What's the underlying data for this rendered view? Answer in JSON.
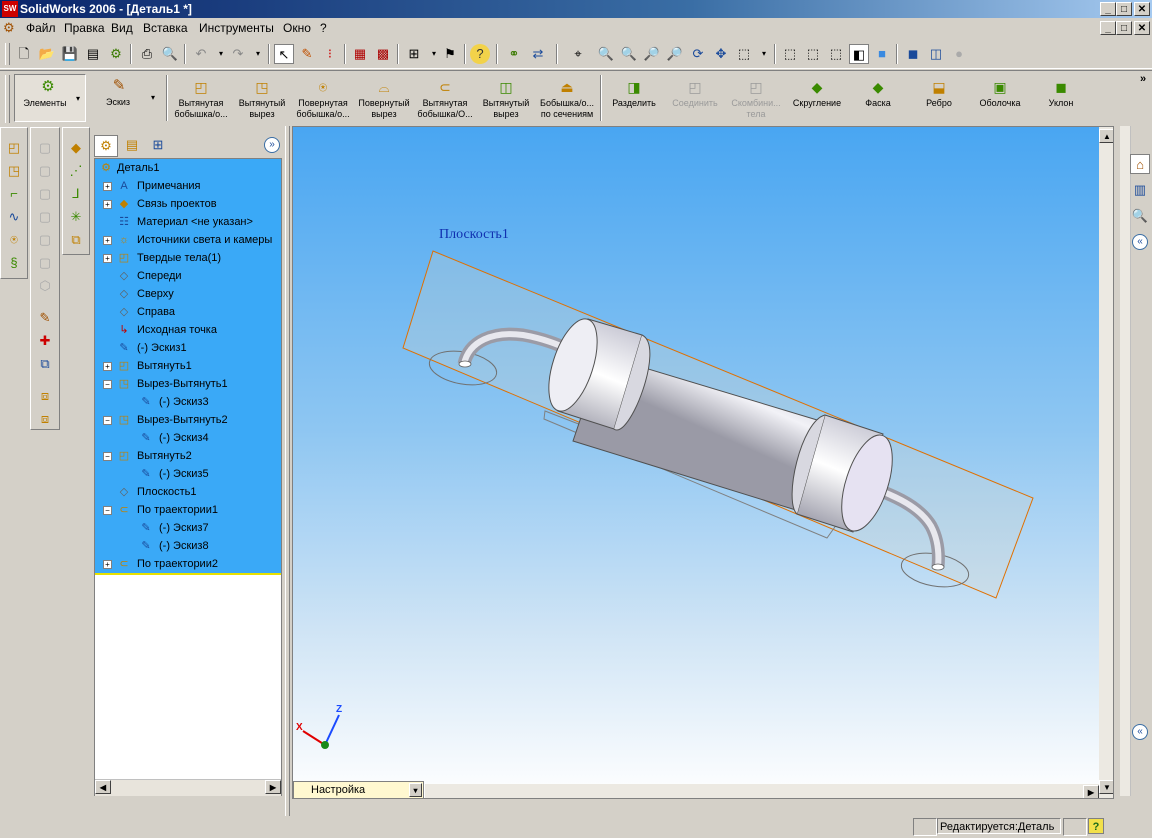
{
  "app": {
    "title": "SolidWorks 2006 - [Деталь1 *]",
    "icon": "SW"
  },
  "window_buttons": {
    "minimize": "_",
    "maximize": "□",
    "close": "✕"
  },
  "menu": [
    "Файл",
    "Правка",
    "Вид",
    "Вставка",
    "Инструменты",
    "Окно",
    "?"
  ],
  "command_manager": {
    "tabs": [
      {
        "label": "Элементы",
        "icon": "features-icon"
      },
      {
        "label": "Эскиз",
        "icon": "sketch-icon"
      }
    ],
    "commands": [
      {
        "label": "Вытянутая бобышка/о...",
        "icon": "extruded-boss-icon",
        "enabled": true
      },
      {
        "label": "Вытянутый вырез",
        "icon": "extruded-cut-icon",
        "enabled": true
      },
      {
        "label": "Повернутая бобышка/о...",
        "icon": "revolved-boss-icon",
        "enabled": true
      },
      {
        "label": "Повернутый вырез",
        "icon": "revolved-cut-icon",
        "enabled": true
      },
      {
        "label": "Вытянутая бобышка/О...",
        "icon": "swept-boss-icon",
        "enabled": true
      },
      {
        "label": "Вытянутый вырез",
        "icon": "swept-cut-icon",
        "enabled": true
      },
      {
        "label": "Бобышка/о... по сечениям",
        "icon": "loft-icon",
        "enabled": true
      },
      {
        "label": "Разделить",
        "icon": "split-icon",
        "enabled": true
      },
      {
        "label": "Соединить",
        "icon": "join-icon",
        "enabled": false
      },
      {
        "label": "Скомбини... тела",
        "icon": "combine-icon",
        "enabled": false
      },
      {
        "label": "Скругление",
        "icon": "fillet-icon",
        "enabled": true
      },
      {
        "label": "Фаска",
        "icon": "chamfer-icon",
        "enabled": true
      },
      {
        "label": "Ребро",
        "icon": "rib-icon",
        "enabled": true
      },
      {
        "label": "Оболочка",
        "icon": "shell-icon",
        "enabled": true
      },
      {
        "label": "Уклон",
        "icon": "draft-icon",
        "enabled": true
      }
    ],
    "more": "»"
  },
  "tree": {
    "root": "Деталь1",
    "items": [
      {
        "label": "Примечания",
        "icon": "annotations-icon",
        "expand": "+",
        "indent": 0
      },
      {
        "label": "Связь проектов",
        "icon": "design-binder-icon",
        "expand": "+",
        "indent": 0
      },
      {
        "label": "Материал <не указан>",
        "icon": "material-icon",
        "expand": "",
        "indent": 0
      },
      {
        "label": "Источники света и камеры",
        "icon": "lights-icon",
        "expand": "+",
        "indent": 0
      },
      {
        "label": "Твердые тела(1)",
        "icon": "solid-bodies-icon",
        "expand": "+",
        "indent": 0
      },
      {
        "label": "Спереди",
        "icon": "plane-icon",
        "expand": "",
        "indent": 0
      },
      {
        "label": "Сверху",
        "icon": "plane-icon",
        "expand": "",
        "indent": 0
      },
      {
        "label": "Справа",
        "icon": "plane-icon",
        "expand": "",
        "indent": 0
      },
      {
        "label": "Исходная точка",
        "icon": "origin-icon",
        "expand": "",
        "indent": 0
      },
      {
        "label": "(-) Эскиз1",
        "icon": "sketch-icon",
        "expand": "",
        "indent": 0
      },
      {
        "label": "Вытянуть1",
        "icon": "extrude-icon",
        "expand": "+",
        "indent": 0
      },
      {
        "label": "Вырез-Вытянуть1",
        "icon": "cut-extrude-icon",
        "expand": "−",
        "indent": 0
      },
      {
        "label": "(-) Эскиз3",
        "icon": "sketch-icon",
        "expand": "",
        "indent": 1
      },
      {
        "label": "Вырез-Вытянуть2",
        "icon": "cut-extrude-icon",
        "expand": "−",
        "indent": 0
      },
      {
        "label": "(-) Эскиз4",
        "icon": "sketch-icon",
        "expand": "",
        "indent": 1
      },
      {
        "label": "Вытянуть2",
        "icon": "extrude-icon",
        "expand": "−",
        "indent": 0
      },
      {
        "label": "(-) Эскиз5",
        "icon": "sketch-icon",
        "expand": "",
        "indent": 1
      },
      {
        "label": "Плоскость1",
        "icon": "plane-icon",
        "expand": "",
        "indent": 0
      },
      {
        "label": "По траектории1",
        "icon": "sweep-icon",
        "expand": "−",
        "indent": 0
      },
      {
        "label": "(-) Эскиз7",
        "icon": "sketch-icon",
        "expand": "",
        "indent": 1
      },
      {
        "label": "(-) Эскиз8",
        "icon": "sketch-icon",
        "expand": "",
        "indent": 1
      },
      {
        "label": "По траектории2",
        "icon": "sweep-icon",
        "expand": "+",
        "indent": 0
      }
    ]
  },
  "viewport": {
    "plane_label": "Плоскость1",
    "triad": {
      "x": "X",
      "z": "Z"
    }
  },
  "config_dropdown": {
    "value": "Настройка"
  },
  "status": {
    "text": "Редактируется:Деталь",
    "help": "?"
  }
}
